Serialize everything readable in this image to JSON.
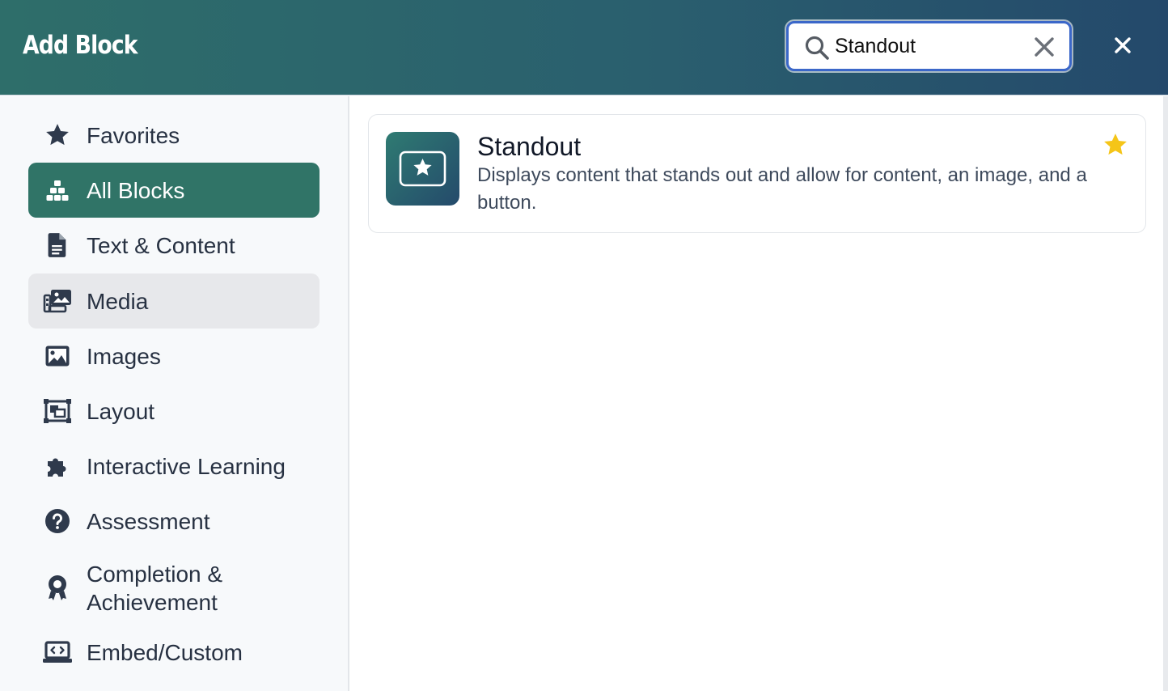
{
  "header": {
    "title": "Add Block",
    "search": {
      "value": "Standout",
      "placeholder": ""
    }
  },
  "sidebar": {
    "items": [
      {
        "label": "Favorites",
        "icon": "star-icon"
      },
      {
        "label": "All Blocks",
        "icon": "blocks-icon",
        "active": true
      },
      {
        "label": "Text & Content",
        "icon": "document-icon"
      },
      {
        "label": "Media",
        "icon": "media-icon",
        "hover": true
      },
      {
        "label": "Images",
        "icon": "image-icon"
      },
      {
        "label": "Layout",
        "icon": "layout-icon"
      },
      {
        "label": "Interactive Learning",
        "icon": "puzzle-icon"
      },
      {
        "label": "Assessment",
        "icon": "question-circle-icon"
      },
      {
        "label": "Completion &\nAchievement",
        "icon": "award-icon"
      },
      {
        "label": "Embed/Custom",
        "icon": "embed-code-icon"
      }
    ]
  },
  "results": [
    {
      "title": "Standout",
      "description": "Displays content that stands out and allow for content, an image, and a button.",
      "icon": "star-box-icon",
      "favorite": true
    }
  ],
  "colors": {
    "header_gradient_start": "#2e6e6a",
    "header_gradient_end": "#24496b",
    "active_nav": "#307467",
    "hover_nav": "#e7e8eb",
    "favorite_star": "#f5c518",
    "search_focus": "#3b67c9"
  }
}
